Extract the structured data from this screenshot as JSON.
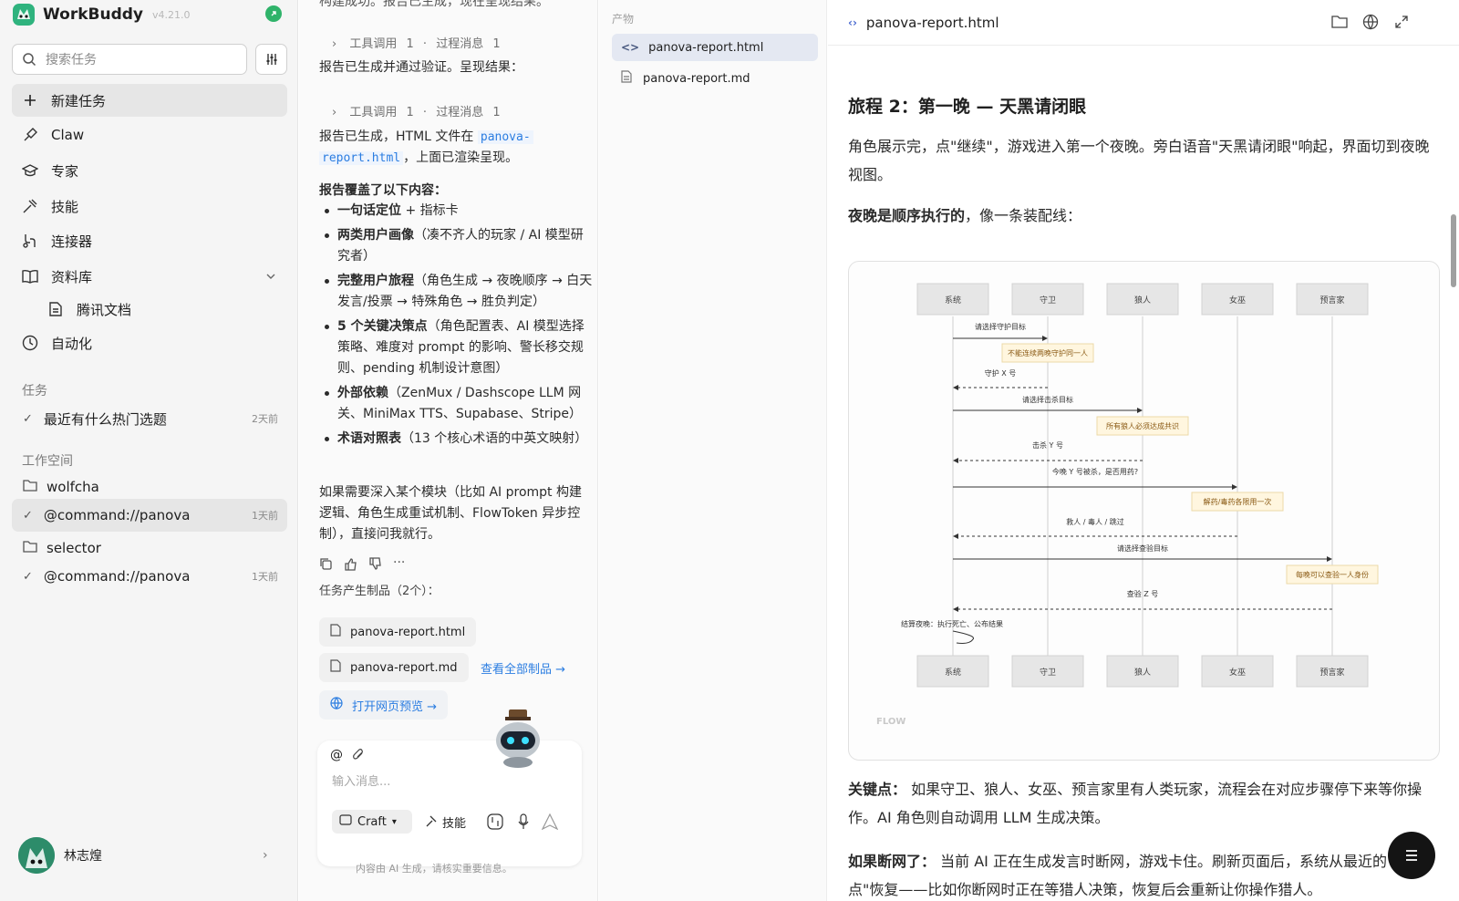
{
  "sidebar": {
    "app_name": "WorkBuddy",
    "version": "v4.21.0",
    "search_placeholder": "搜索任务",
    "nav": [
      {
        "label": "新建任务",
        "icon": "plus-icon"
      },
      {
        "label": "Claw",
        "icon": "claw-icon"
      },
      {
        "label": "专家",
        "icon": "expert-icon"
      },
      {
        "label": "技能",
        "icon": "skill-icon"
      },
      {
        "label": "连接器",
        "icon": "connector-icon"
      },
      {
        "label": "资料库",
        "icon": "library-icon"
      },
      {
        "label": "腾讯文档",
        "icon": "doc-icon"
      },
      {
        "label": "自动化",
        "icon": "clock-icon"
      }
    ],
    "tasks_section": "任务",
    "task_items": [
      {
        "label": "最近有什么热门选题",
        "time": "2天前"
      }
    ],
    "workspace_section": "工作空间",
    "workspaces": [
      {
        "folder": "wolfcha",
        "item": "@command://panova",
        "time": "1天前"
      },
      {
        "folder": "selector",
        "item": "@command://panova",
        "time": "1天前"
      }
    ],
    "user_name": "林志煌"
  },
  "chat": {
    "top_text": "构建成功。报告已生成，现在呈现结果。",
    "tool_calls_label": "工具调用",
    "tool_calls_count": "1",
    "process_label": "过程消息",
    "process_count": "1",
    "msg1": "报告已生成并通过验证。呈现结果：",
    "msg2_prefix": "报告已生成，HTML 文件在",
    "msg2_code1": "panova-",
    "msg2_code2": "report.html",
    "msg2_suffix": "，上面已渲染呈现。",
    "covers_title": "报告覆盖了以下内容：",
    "bullets": [
      {
        "bold": "一句话定位",
        "rest": " + 指标卡"
      },
      {
        "bold": "两类用户画像",
        "rest": "（凑不齐人的玩家 / AI 模型研究者）"
      },
      {
        "bold": "完整用户旅程",
        "rest": "（角色生成 → 夜晚顺序 → 白天发言/投票 → 特殊角色 → 胜负判定）"
      },
      {
        "bold": "5 个关键决策点",
        "rest": "（角色配置表、AI 模型选择策略、难度对 prompt 的影响、警长移交规则、pending 机制设计意图）"
      },
      {
        "bold": "外部依赖",
        "rest": "（ZenMux / Dashscope LLM 网关、MiniMax TTS、Supabase、Stripe）"
      },
      {
        "bold": "术语对照表",
        "rest": "（13 个核心术语的中英文映射）"
      }
    ],
    "followup": "如果需要深入某个模块（比如 AI prompt 构建逻辑、角色生成重试机制、FlowToken 异步控制），直接问我就行。",
    "artifacts_title": "任务产生制品（2个）：",
    "artifact1": "panova-report.html",
    "artifact2": "panova-report.md",
    "view_all": "查看全部制品 →",
    "open_preview": "打开网页预览 →",
    "input_placeholder": "输入消息...",
    "mode": "Craft",
    "skill_btn": "技能",
    "disclaimer": "内容由 AI 生成，请核实重要信息。"
  },
  "files": {
    "section": "产物",
    "items": [
      "panova-report.html",
      "panova-report.md"
    ]
  },
  "preview": {
    "file_title": "panova-report.html",
    "heading": "旅程 2：第一晚 — 天黑请闭眼",
    "p1": "角色展示完，点\"继续\"，游戏进入第一个夜晚。旁白语音\"天黑请闭眼\"响起，界面切到夜晚视图。",
    "p2_bold": "夜晚是顺序执行的",
    "p2_rest": "，像一条装配线：",
    "diagram": {
      "actors": [
        "系统",
        "守卫",
        "狼人",
        "女巫",
        "预言家"
      ],
      "messages": [
        "请选择守护目标",
        "守护 X 号",
        "请选择击杀目标",
        "击杀 Y 号",
        "今晚 Y 号被杀，是否用药?",
        "救人 / 毒人 / 跳过",
        "请选择查验目标",
        "查验 Z 号",
        "结算夜晚：执行死亡、公布结果"
      ],
      "notes": [
        "不能连续两晚守护同一人",
        "所有狼人必须达成共识",
        "解药/毒药各限用一次",
        "每晚可以查验一人身份"
      ],
      "label": "FLOW"
    },
    "p3_bold": "关键点：",
    "p3_rest": " 如果守卫、狼人、女巫、预言家里有人类玩家，流程会在对应步骤停下来等你操作。AI 角色则自动调用 LLM 生成决策。",
    "p4_bold": "如果断网了：",
    "p4_rest": " 当前 AI 正在生成发言时断网，游戏卡住。刷新页面后，系统从最近的\"检查点\"恢复——比如你断网时正在等猎人决策，恢复后会重新让你操作猎人。"
  }
}
